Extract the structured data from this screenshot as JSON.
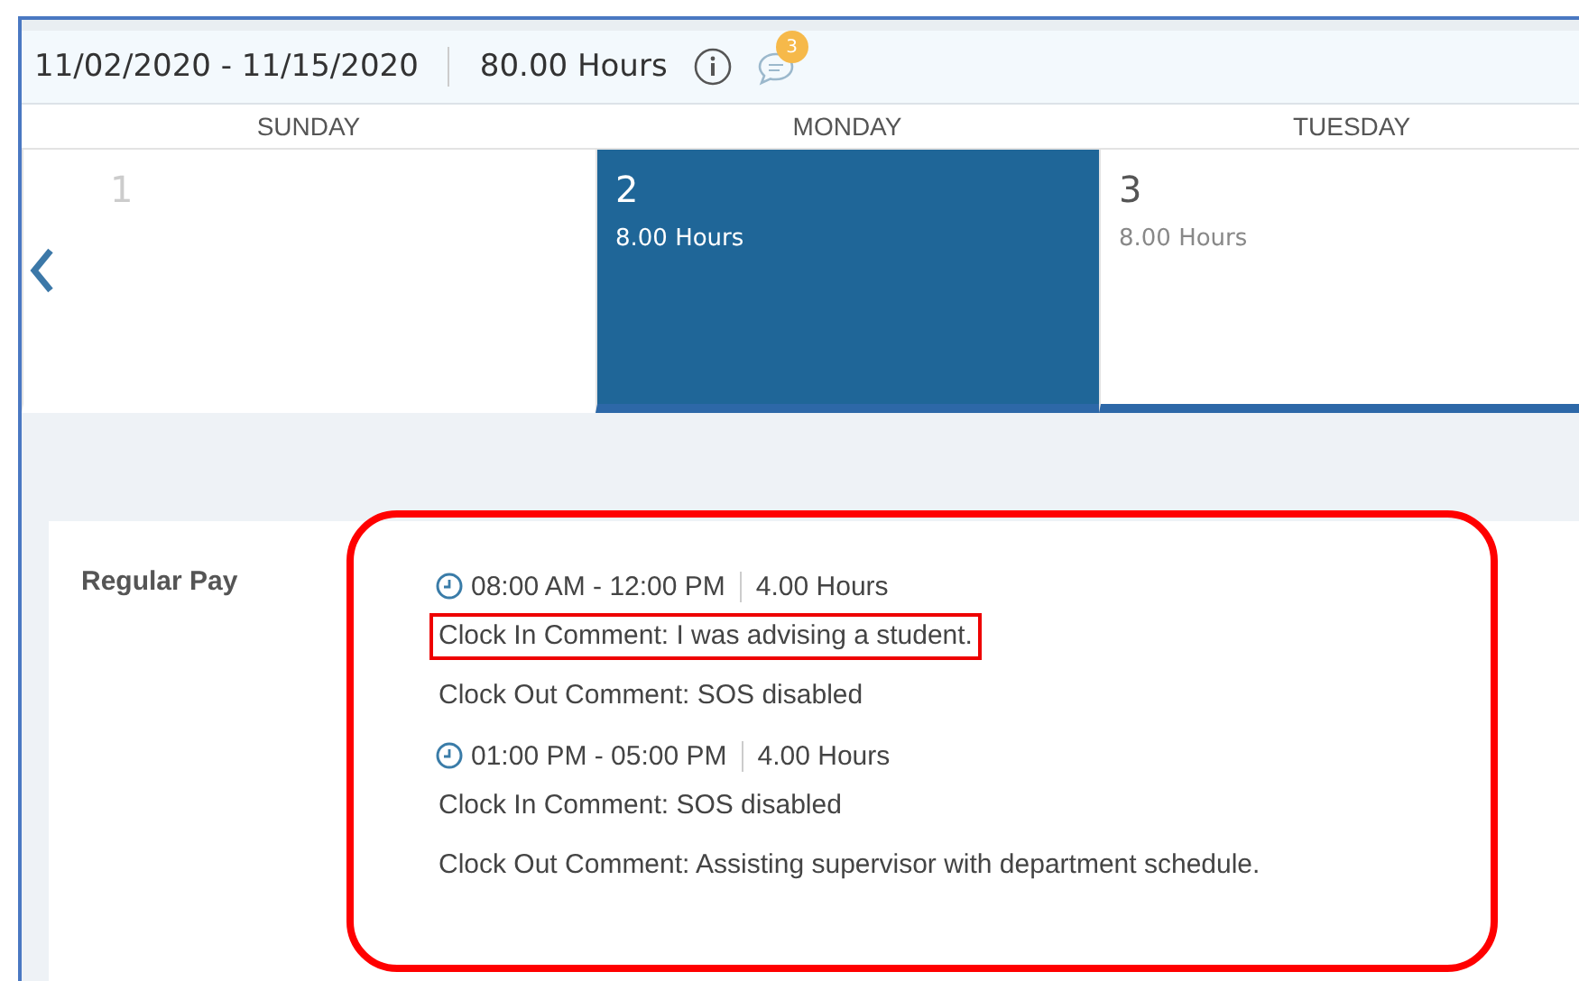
{
  "header": {
    "period": "11/02/2020 - 11/15/2020",
    "total": "80.00 Hours",
    "comment_count": "3"
  },
  "days": [
    {
      "name": "SUNDAY",
      "date": "1",
      "selected": false,
      "dimmed": true
    },
    {
      "name": "MONDAY",
      "date": "2",
      "hours": "8.00 Hours",
      "selected": true,
      "dimmed": false
    },
    {
      "name": "TUESDAY",
      "date": "3",
      "hours": "8.00 Hours",
      "selected": false,
      "dimmed": false
    }
  ],
  "detail": {
    "label": "Regular Pay",
    "entries": [
      {
        "time": "08:00 AM - 12:00 PM",
        "hours": "4.00 Hours",
        "comments": [
          {
            "text": "Clock In Comment: I was advising a student.",
            "highlighted": true
          },
          {
            "text": "Clock Out Comment: SOS disabled",
            "highlighted": false
          }
        ]
      },
      {
        "time": "01:00 PM - 05:00 PM",
        "hours": "4.00 Hours",
        "comments": [
          {
            "text": "Clock In Comment: SOS disabled",
            "highlighted": false
          },
          {
            "text": "Clock Out Comment: Assisting supervisor with department schedule.",
            "highlighted": false
          }
        ]
      }
    ]
  }
}
